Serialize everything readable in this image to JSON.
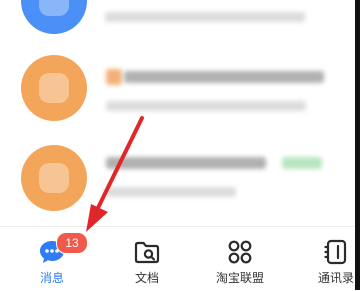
{
  "tabbar": {
    "tabs": [
      {
        "label": "消息",
        "icon": "chat-bubble-icon",
        "active": true
      },
      {
        "label": "文档",
        "icon": "folder-icon",
        "active": false
      },
      {
        "label": "淘宝联盟",
        "icon": "grid-icon",
        "active": false
      },
      {
        "label": "通讯录",
        "icon": "contacts-icon",
        "active": false
      }
    ],
    "badge_count": "13"
  },
  "colors": {
    "accent": "#2f7cf6",
    "badge": "#f15a4a",
    "arrow": "#e0262a",
    "avatar_blue": "#4a90f6",
    "avatar_orange": "#f3a55a"
  }
}
